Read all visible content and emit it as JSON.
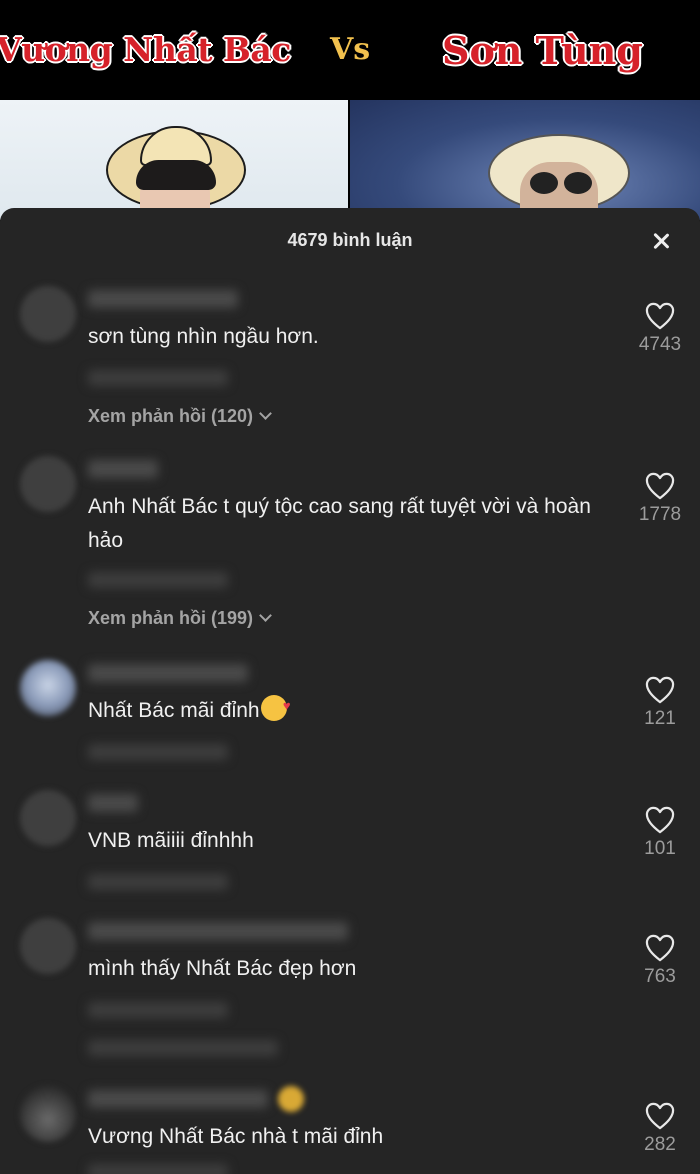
{
  "banner": {
    "left_name": "Vương Nhất Bác",
    "vs": "Vs",
    "right_name": "Sơn Tùng"
  },
  "sheet": {
    "title": "4679 bình luận",
    "close_icon": "close-icon"
  },
  "comments": [
    {
      "text": "sơn tùng nhìn ngầu hơn.",
      "likes": "4743",
      "replies": "Xem phản hồi (120)"
    },
    {
      "text": "Anh Nhất Bác t quý tộc cao sang rất tuyệt vời và hoàn hảo",
      "likes": "1778",
      "replies": "Xem phản hồi (199)"
    },
    {
      "text": "Nhất Bác mãi đỉnh",
      "likes": "121",
      "emoji": "smiling-face-with-hearts-emoji"
    },
    {
      "text": "VNB mãiiii đỉnhhh",
      "likes": "101"
    },
    {
      "text": "mình thấy Nhất Bác đẹp hơn",
      "likes": "763"
    },
    {
      "text": "Vương Nhất Bác nhà t mãi đỉnh",
      "likes": "282"
    }
  ],
  "colors": {
    "sheet_bg": "#252525",
    "text": "#f0f0f0",
    "muted": "#a4a4a4",
    "banner_red": "#d6222a",
    "banner_gold": "#f2c14e"
  }
}
